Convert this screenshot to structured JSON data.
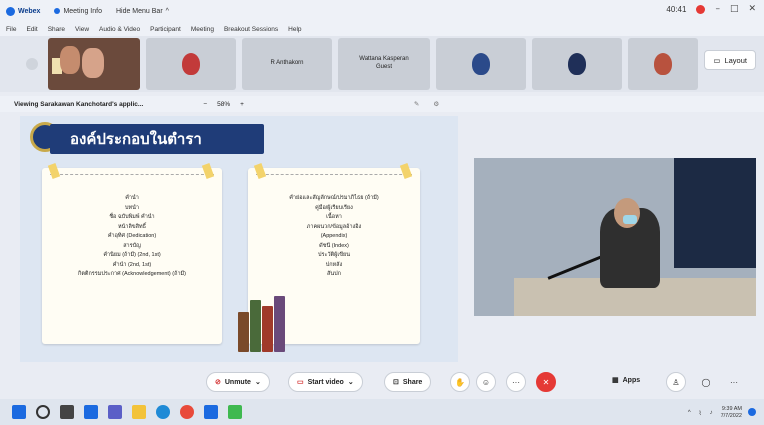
{
  "titlebar": {
    "app_name": "Webex",
    "meeting_label": "Meeting Info",
    "host_label": "Hide Menu Bar",
    "time": "40:41"
  },
  "menu": [
    "File",
    "Edit",
    "Share",
    "View",
    "Audio & Video",
    "Participant",
    "Meeting",
    "Breakout Sessions",
    "Help"
  ],
  "participants": [
    {
      "name": "",
      "type": "camera"
    },
    {
      "name": "",
      "type": "avatar",
      "color": "#c23a3a"
    },
    {
      "name": "R Anthakorn",
      "type": "name"
    },
    {
      "name": "Wattana Kasperan",
      "sub": "Guest",
      "type": "name"
    },
    {
      "name": "",
      "type": "avatar",
      "color": "#2b4a8a"
    },
    {
      "name": "",
      "type": "avatar",
      "color": "#1f2f58"
    },
    {
      "name": "",
      "type": "avatar",
      "color": "#b8523e"
    }
  ],
  "layout_button": "Layout",
  "viewing": {
    "label": "Viewing Sarakawan Kanchotard's applic...",
    "zoom_minus": "−",
    "zoom": "58%",
    "zoom_plus": "+"
  },
  "slide": {
    "heading": "องค์ประกอบในตำรา",
    "left_card": [
      "คำนำ",
      "บทนำ",
      "ชื่อ ฉบับพิมพ์ คำนำ",
      "หน้าลิขสิทธิ์",
      "คำอุทิศ (Dedication)",
      "สารบัญ",
      "คำนิยม (ถ้ามี) (2nd, 1st)",
      "คำนำ (2nd, 1st)",
      "กิตติกรรมประกาศ (Acknowledgement) (ถ้ามี)"
    ],
    "right_card": [
      "คำย่อและสัญลักษณ์/ปรมาภิไธย (ถ้ามี)",
      "คู่มือ/ผู้เรียบเรียง",
      "เนื้อหา",
      "ภาคผนวก/ข้อมูลอ้างอิง",
      "(Appendix)",
      "ดัชนี (Index)",
      "ประวัติผู้เขียน",
      "ปกหลัง",
      "สันปก"
    ]
  },
  "toolbar": {
    "unmute": "Unmute",
    "start_video": "Start video",
    "share": "Share",
    "apps": "Apps"
  },
  "tray": {
    "time": "9:39 AM",
    "date": "7/7/2022"
  },
  "colors": {
    "accent": "#1b6ae0",
    "leave": "#e53935",
    "slide_header": "#1f3c78"
  }
}
